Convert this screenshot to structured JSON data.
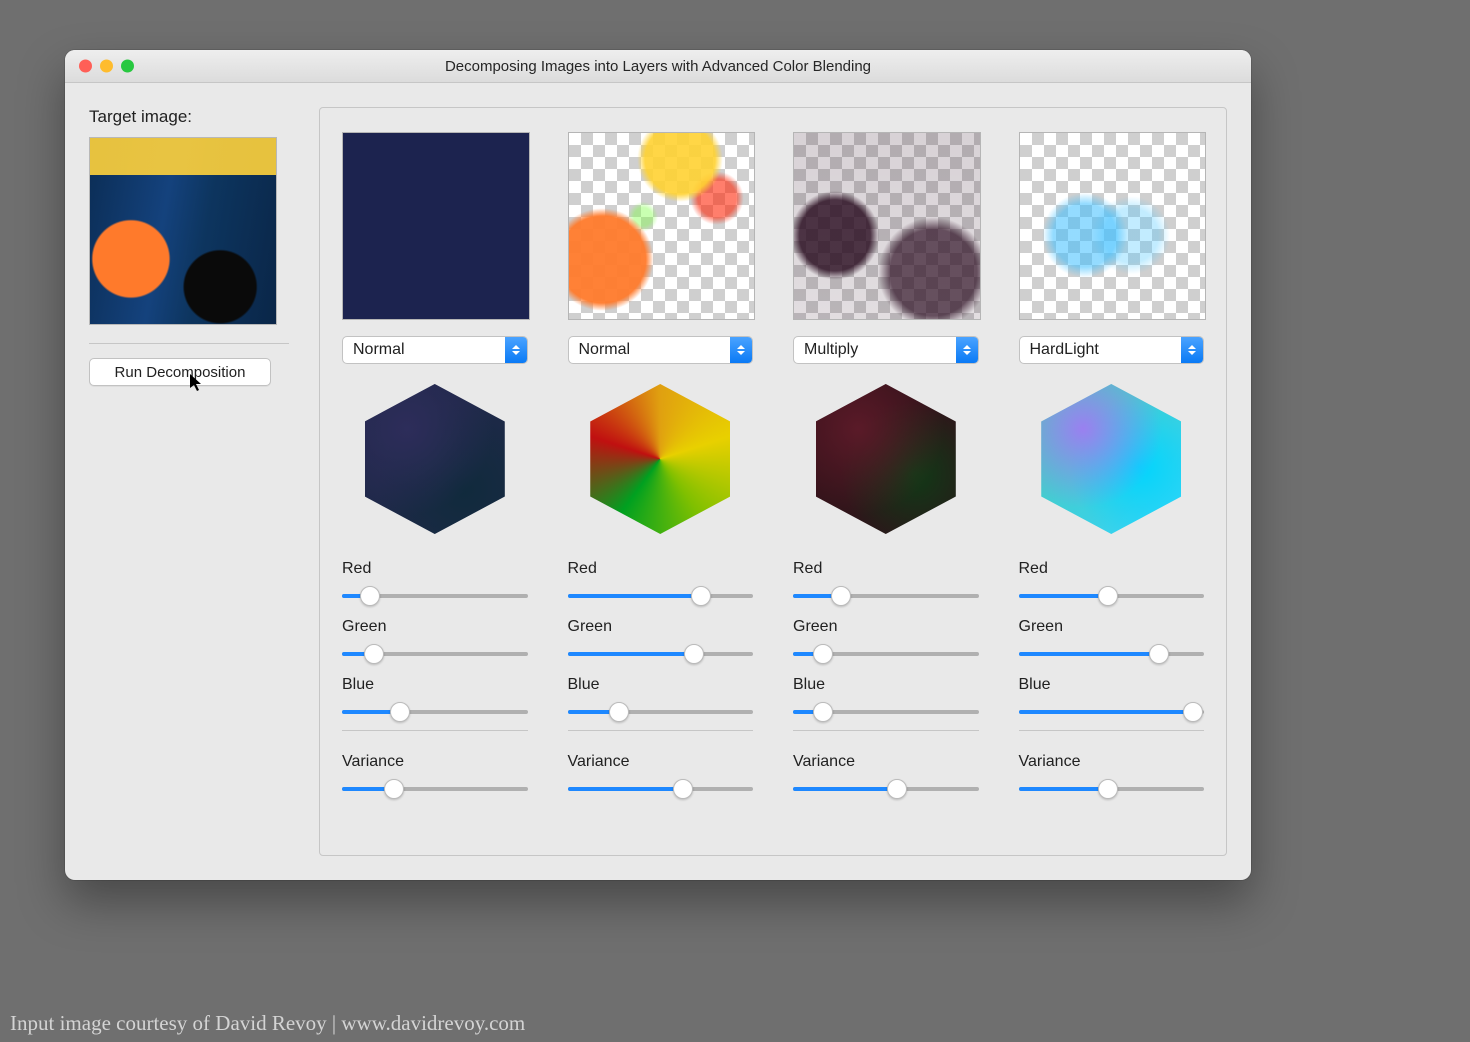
{
  "window": {
    "title": "Decomposing Images into Layers with Advanced Color Blending"
  },
  "sidebar": {
    "label": "Target image:",
    "run_label": "Run Decomposition"
  },
  "slider_labels": {
    "red": "Red",
    "green": "Green",
    "blue": "Blue",
    "variance": "Variance"
  },
  "layers": [
    {
      "mode": "Normal",
      "red": 15,
      "green": 17,
      "blue": 31,
      "variance": 28
    },
    {
      "mode": "Normal",
      "red": 72,
      "green": 68,
      "blue": 28,
      "variance": 62
    },
    {
      "mode": "Multiply",
      "red": 26,
      "green": 16,
      "blue": 16,
      "variance": 56
    },
    {
      "mode": "HardLight",
      "red": 48,
      "green": 76,
      "blue": 94,
      "variance": 48
    }
  ],
  "credit": "Input image courtesy of David Revoy | www.davidrevoy.com"
}
